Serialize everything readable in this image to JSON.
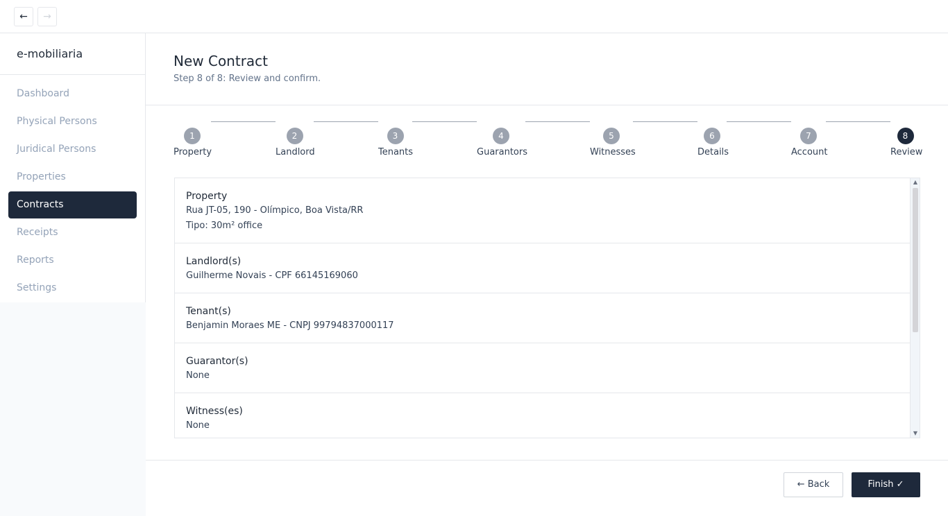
{
  "nav": {
    "back_glyph": "←",
    "forward_glyph": "→"
  },
  "brand": "e-mobiliaria",
  "sidebar": {
    "items": [
      {
        "label": "Dashboard"
      },
      {
        "label": "Physical Persons"
      },
      {
        "label": "Juridical Persons"
      },
      {
        "label": "Properties"
      },
      {
        "label": "Contracts",
        "active": true
      },
      {
        "label": "Receipts"
      },
      {
        "label": "Reports"
      },
      {
        "label": "Settings"
      }
    ]
  },
  "header": {
    "title": "New Contract",
    "subtitle": "Step 8 of 8: Review and confirm."
  },
  "steps": [
    {
      "number": "1",
      "label": "Property"
    },
    {
      "number": "2",
      "label": "Landlord"
    },
    {
      "number": "3",
      "label": "Tenants"
    },
    {
      "number": "4",
      "label": "Guarantors"
    },
    {
      "number": "5",
      "label": "Witnesses"
    },
    {
      "number": "6",
      "label": "Details"
    },
    {
      "number": "7",
      "label": "Account"
    },
    {
      "number": "8",
      "label": "Review",
      "active": true
    }
  ],
  "review": {
    "items": [
      {
        "heading": "Property",
        "lines": [
          "Rua JT-05, 190 - Olímpico, Boa Vista/RR",
          "Tipo: 30m² office"
        ]
      },
      {
        "heading": "Landlord(s)",
        "lines": [
          "Guilherme Novais - CPF 66145169060"
        ]
      },
      {
        "heading": "Tenant(s)",
        "lines": [
          "Benjamin Moraes ME - CNPJ 99794837000117"
        ]
      },
      {
        "heading": "Guarantor(s)",
        "lines": [
          "None"
        ]
      },
      {
        "heading": "Witness(es)",
        "lines": [
          "None"
        ]
      }
    ]
  },
  "footer": {
    "back_label": "← Back",
    "finish_label": "Finish ✓"
  },
  "colors": {
    "primary": "#1e293b",
    "step_inactive": "#9ca3af",
    "muted_text": "#94a3b8"
  }
}
